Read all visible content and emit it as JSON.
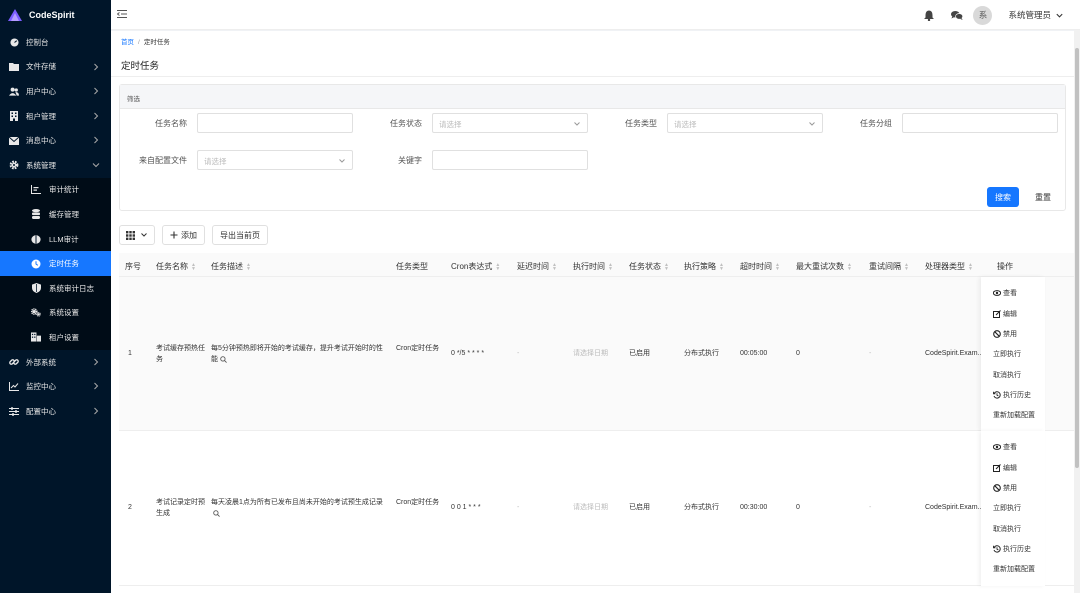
{
  "app": {
    "name": "CodeSpirit"
  },
  "sidebar": {
    "items": [
      {
        "label": "控制台",
        "icon": "dashboard-icon",
        "expandable": false
      },
      {
        "label": "文件存储",
        "icon": "folder-icon",
        "expandable": true
      },
      {
        "label": "用户中心",
        "icon": "users-icon",
        "expandable": true
      },
      {
        "label": "租户管理",
        "icon": "building-icon",
        "expandable": true
      },
      {
        "label": "消息中心",
        "icon": "envelope-icon",
        "expandable": true
      },
      {
        "label": "系统管理",
        "icon": "gear-icon",
        "expandable": true,
        "expanded": true
      }
    ],
    "sub_items": [
      {
        "label": "审计统计",
        "icon": "chart-icon"
      },
      {
        "label": "缓存管理",
        "icon": "database-icon"
      },
      {
        "label": "LLM审计",
        "icon": "brain-icon"
      },
      {
        "label": "定时任务",
        "icon": "clock-icon",
        "active": true
      },
      {
        "label": "系统审计日志",
        "icon": "shield-icon"
      },
      {
        "label": "系统设置",
        "icon": "gears-icon"
      },
      {
        "label": "租户设置",
        "icon": "building-grid-icon"
      }
    ],
    "bottom_items": [
      {
        "label": "外部系统",
        "icon": "link-icon",
        "expandable": true
      },
      {
        "label": "监控中心",
        "icon": "line-chart-icon",
        "expandable": true
      },
      {
        "label": "配置中心",
        "icon": "sliders-icon",
        "expandable": true
      }
    ]
  },
  "header": {
    "avatar_text": "系",
    "user_name": "系统管理员"
  },
  "breadcrumb": {
    "home": "首页",
    "current": "定时任务"
  },
  "page": {
    "title": "定时任务"
  },
  "filter": {
    "title": "筛选",
    "fields": {
      "task_name": {
        "label": "任务名称",
        "placeholder": ""
      },
      "task_status": {
        "label": "任务状态",
        "placeholder": "请选择"
      },
      "task_type": {
        "label": "任务类型",
        "placeholder": "请选择"
      },
      "task_group": {
        "label": "任务分组",
        "placeholder": ""
      },
      "from_config": {
        "label": "来自配置文件",
        "placeholder": "请选择"
      },
      "keyword": {
        "label": "关键字",
        "placeholder": ""
      }
    },
    "search_label": "搜索",
    "reset_label": "重置"
  },
  "toolbar": {
    "add_label": "添加",
    "export_label": "导出当前页"
  },
  "table": {
    "columns": [
      "序号",
      "任务名称",
      "任务描述",
      "任务类型",
      "Cron表达式",
      "延迟时间",
      "执行时间",
      "任务状态",
      "执行策略",
      "超时时间",
      "最大重试次数",
      "重试间隔",
      "处理器类型",
      "操作"
    ],
    "rows": [
      {
        "index": "1",
        "name": "考试缓存预热任务",
        "description": "每5分钟预热即将开始的考试缓存，提升考试开始时的性能",
        "type": "Cron定时任务",
        "cron": "0 */5 * * * *",
        "delay": "-",
        "exec_time": "请选择日期",
        "status": "已启用",
        "strategy": "分布式执行",
        "timeout": "00:05:00",
        "max_retries": "0",
        "retry_interval": "-",
        "handler": "CodeSpirit.Exam..."
      },
      {
        "index": "2",
        "name": "考试记录定时预生成",
        "description": "每天凌晨1点为所有已发布且尚未开始的考试预生成记录",
        "type": "Cron定时任务",
        "cron": "0 0 1 * * *",
        "delay": "-",
        "exec_time": "请选择日期",
        "status": "已启用",
        "strategy": "分布式执行",
        "timeout": "00:30:00",
        "max_retries": "0",
        "retry_interval": "-",
        "handler": "CodeSpirit.Exam..."
      }
    ],
    "actions": [
      "查看",
      "编辑",
      "禁用",
      "立即执行",
      "取消执行",
      "执行历史",
      "重新加载配置"
    ]
  }
}
